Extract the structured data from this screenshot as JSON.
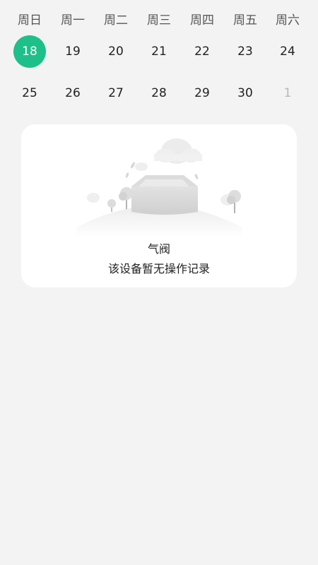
{
  "calendar": {
    "weekdays": [
      "周日",
      "周一",
      "周二",
      "周三",
      "周四",
      "周五",
      "周六"
    ],
    "week1": [
      "18",
      "19",
      "20",
      "21",
      "22",
      "23",
      "24"
    ],
    "week2": [
      "25",
      "26",
      "27",
      "28",
      "29",
      "30",
      "1"
    ],
    "selected_day": "18",
    "selected_color": "#1fbf8a"
  },
  "empty_state": {
    "device_name": "气阀",
    "message": "该设备暂无操作记录",
    "illustration": "empty-box-icon"
  }
}
